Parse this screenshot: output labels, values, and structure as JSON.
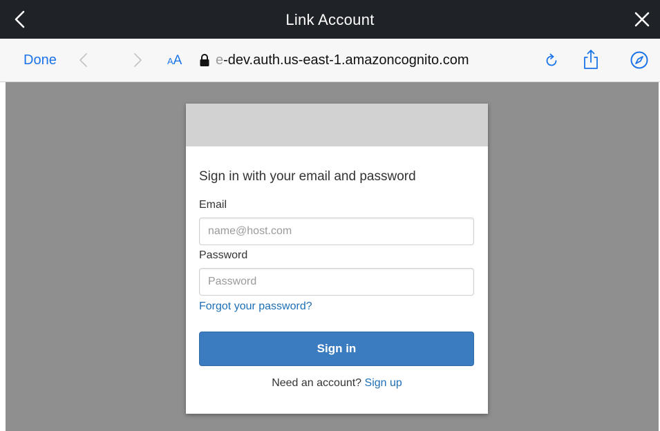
{
  "window": {
    "title": "Link Account",
    "back_icon": "chevron-left-icon",
    "close_icon": "close-icon"
  },
  "toolbar": {
    "done_label": "Done",
    "aa_small": "A",
    "aa_big": "A",
    "url_faded": "e",
    "url_main": "-dev.auth.us-east-1.amazoncognito.com",
    "accent_color": "#1a73e8"
  },
  "form": {
    "heading": "Sign in with your email and password",
    "email_label": "Email",
    "email_value": "",
    "email_placeholder": "name@host.com",
    "password_label": "Password",
    "password_value": "",
    "password_placeholder": "Password",
    "forgot_link": "Forgot your password?",
    "signin_button": "Sign in",
    "need_account_text": "Need an account?",
    "signup_link": "Sign up",
    "primary_color": "#3a7cbf",
    "link_color": "#1e6fb5"
  }
}
